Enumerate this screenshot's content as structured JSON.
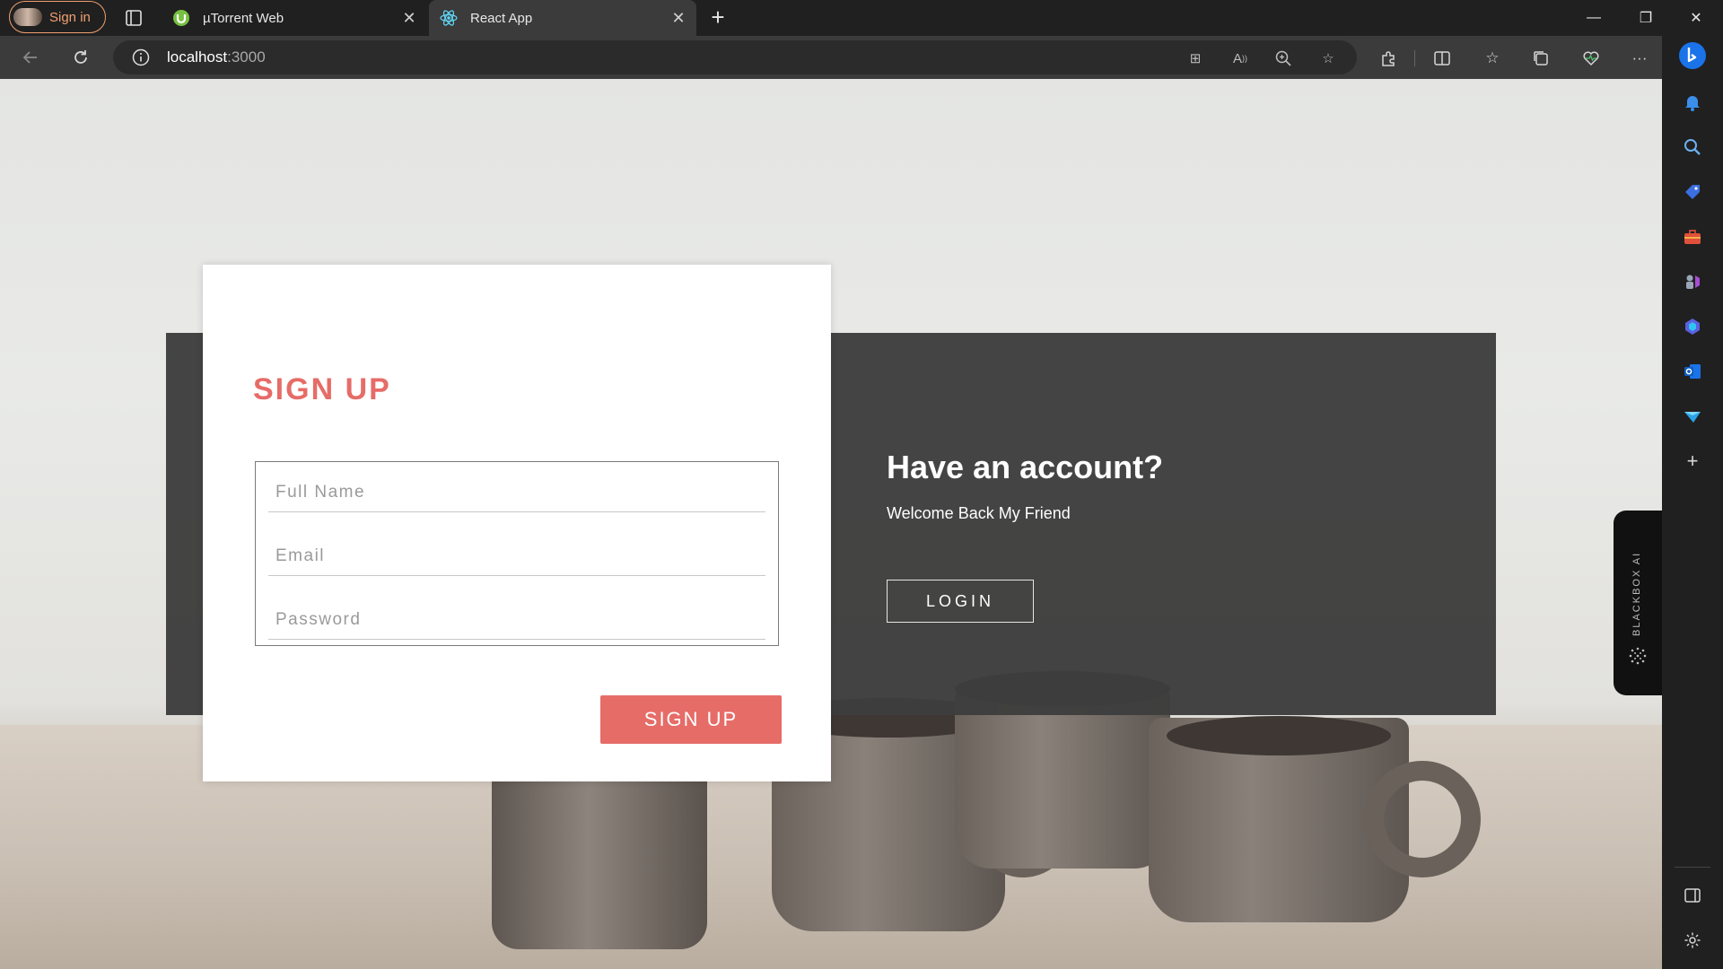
{
  "browser": {
    "profile_label": "Sign in",
    "tabs": [
      {
        "title": "µTorrent Web",
        "icon": "utorrent-icon"
      },
      {
        "title": "React App",
        "icon": "react-icon",
        "active": true
      }
    ],
    "url_host": "localhost",
    "url_path": ":3000"
  },
  "colors": {
    "accent": "#e66c68",
    "panel": "#3e3e3e"
  },
  "signup": {
    "title": "SIGN UP",
    "fields": {
      "full_name_placeholder": "Full Name",
      "email_placeholder": "Email",
      "password_placeholder": "Password"
    },
    "button_label": "SIGN UP"
  },
  "login_panel": {
    "title": "Have an account?",
    "subtitle": "Welcome Back My Friend",
    "button_label": "LOGIN"
  },
  "blackbox": {
    "label": "BLACKBOX AI"
  }
}
